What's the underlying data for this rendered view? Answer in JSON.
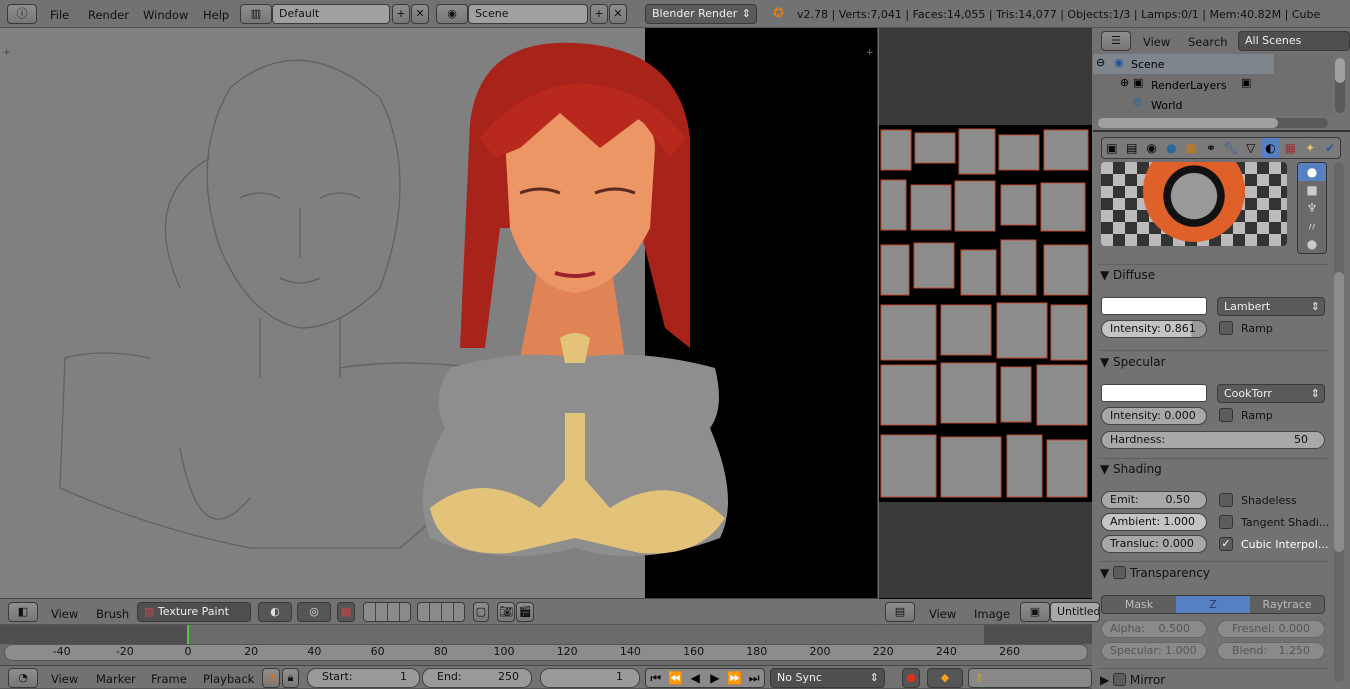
{
  "topbar": {
    "menus": [
      "File",
      "Render",
      "Window",
      "Help"
    ],
    "layout": "Default",
    "scene": "Scene",
    "engine": "Blender Render",
    "stats": "v2.78 | Verts:7,041 | Faces:14,055 | Tris:14,077 | Objects:1/3 | Lamps:0/1 | Mem:40.82M | Cube"
  },
  "outliner": {
    "view": "View",
    "search": "Search",
    "filter": "All Scenes",
    "items": [
      "Scene",
      "RenderLayers",
      "World"
    ]
  },
  "properties": {
    "tabs": [
      "render-icon",
      "render-layers-icon",
      "scene-icon",
      "world-icon",
      "object-icon",
      "constraints-icon",
      "modifier-icon",
      "data-icon",
      "material-icon",
      "texture-icon",
      "particles-icon",
      "physics-icon"
    ],
    "diffuse": {
      "title": "Diffuse",
      "shader": "Lambert",
      "intensity": "Intensity: 0.861",
      "intensity_value": 0.861,
      "ramp": "Ramp",
      "color": "#ffffff"
    },
    "specular": {
      "title": "Specular",
      "shader": "CookTorr",
      "intensity": "Intensity: 0.000",
      "ramp": "Ramp",
      "hardness_label": "Hardness:",
      "hardness": "50",
      "color": "#ffffff"
    },
    "shading": {
      "title": "Shading",
      "emit_label": "Emit:",
      "emit": "0.50",
      "ambient": "Ambient: 1.000",
      "transluc": "Transluc: 0.000",
      "shadeless": "Shadeless",
      "tangent": "Tangent Shadi...",
      "cubic": "Cubic Interpol...",
      "cubic_checked": true
    },
    "transparency": {
      "title": "Transparency",
      "modes": [
        "Mask",
        "Z Transpare...",
        "Raytrace"
      ],
      "active_mode": "Z Transpare...",
      "alpha_label": "Alpha:",
      "alpha": "0.500",
      "fresnel_label": "Fresnel:",
      "fresnel": "0.000",
      "specular": "Specular: 1.000",
      "blend_label": "Blend:",
      "blend": "1.250"
    },
    "mirror": {
      "title": "Mirror"
    }
  },
  "viewport_header": {
    "view": "View",
    "brush": "Brush",
    "mode": "Texture Paint"
  },
  "image_header": {
    "view": "View",
    "image": "Image",
    "name": "Untitled"
  },
  "timeline": {
    "ticks": [
      "-40",
      "-20",
      "0",
      "20",
      "40",
      "60",
      "80",
      "100",
      "120",
      "140",
      "160",
      "180",
      "200",
      "220",
      "240",
      "260"
    ],
    "current_frame": 1
  },
  "timeline_header": {
    "view": "View",
    "marker": "Marker",
    "frame": "Frame",
    "playback": "Playback",
    "start_label": "Start:",
    "start": "1",
    "end_label": "End:",
    "end": "250",
    "current": "1",
    "sync": "No Sync"
  },
  "colors": {
    "accent": "#5680c2",
    "hair": "#b3261c",
    "skin": "#e88a5a",
    "cloth": "#8d8d8d",
    "gold": "#e3c27a"
  }
}
